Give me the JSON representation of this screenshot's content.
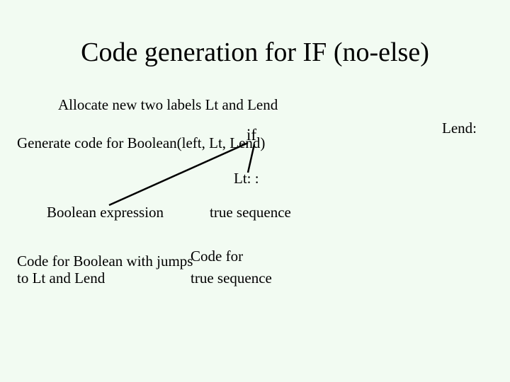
{
  "title": "Code generation for IF (no-else)",
  "allocate_line": "Allocate new two labels Lt and Lend",
  "generate_line": "Generate code for Boolean(left, Lt, Lend)",
  "if_label": "if",
  "lt_label": "Lt: :",
  "lend_label": "Lend:",
  "bool_expr": "Boolean expression",
  "true_seq": "true sequence",
  "bottom_left_l1": "Code for Boolean with jumps",
  "bottom_left_l2": "to Lt and Lend",
  "bottom_right_l1": "Code for",
  "bottom_right_l2": "true sequence"
}
